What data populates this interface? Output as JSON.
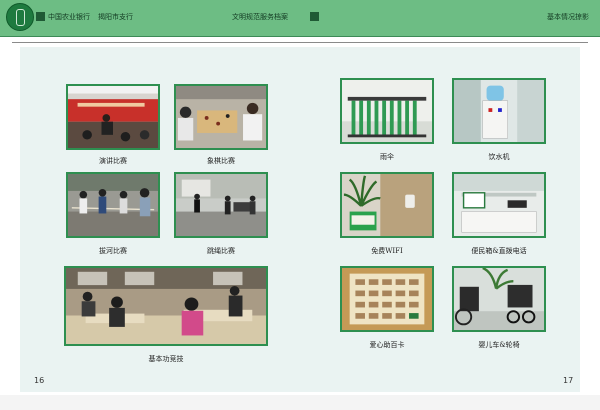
{
  "header": {
    "bank_name": "中国农业银行",
    "branch_name": "揭阳市支行",
    "center_title": "文明规范服务档案",
    "section_title": "基本情况掠影"
  },
  "colors": {
    "header_green": "#6dbd84",
    "dark_green": "#1f5a35",
    "frame_green": "#2e8f50",
    "page_bg": "#eaf3f2"
  },
  "left_page": {
    "page_number": "16",
    "photos": [
      {
        "caption": "演讲比赛"
      },
      {
        "caption": "象棋比赛"
      },
      {
        "caption": "拔河比赛"
      },
      {
        "caption": "跳绳比赛"
      },
      {
        "caption": "基本功竞技"
      }
    ]
  },
  "right_page": {
    "page_number": "17",
    "photos": [
      {
        "caption": "雨伞"
      },
      {
        "caption": "饮水机"
      },
      {
        "caption": "免费WIFI"
      },
      {
        "caption": "便民箱&直拨电话"
      },
      {
        "caption": "爱心助百卡"
      },
      {
        "caption": "婴儿车&轮椅"
      }
    ]
  }
}
